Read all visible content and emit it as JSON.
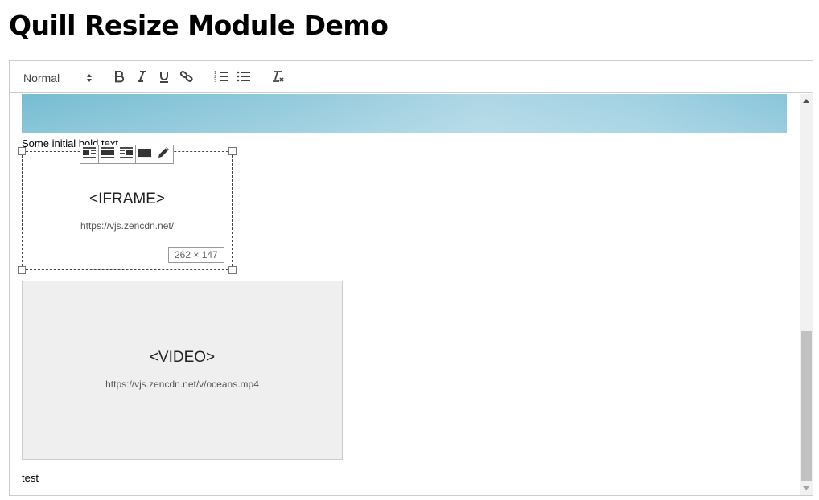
{
  "page": {
    "title": "Quill Resize Module Demo"
  },
  "toolbar": {
    "header_select": {
      "selected": "Normal"
    },
    "buttons": [
      "bold-icon",
      "italic-icon",
      "underline-icon",
      "link-icon",
      "ordered-list-icon",
      "bullet-list-icon",
      "clean-formatting-icon"
    ]
  },
  "content": {
    "hero_image": {
      "alt": "ocean image"
    },
    "bold_text": "Some initial bold text",
    "iframe": {
      "tag": "<IFRAME>",
      "src": "https://vjs.zencdn.net/"
    },
    "video": {
      "tag": "<VIDEO>",
      "src": "https://vjs.zencdn.net/v/oceans.mp4"
    },
    "trailing_text": "test"
  },
  "resize": {
    "size_label": "262 × 147",
    "align_toolbar": [
      "align-left-icon",
      "align-center-icon",
      "align-right-icon",
      "align-full-icon",
      "edit-pencil-icon"
    ]
  },
  "colors": {
    "border": "#cccccc",
    "video_bg": "#efefef",
    "scroll_thumb": "#c1c1c1"
  }
}
